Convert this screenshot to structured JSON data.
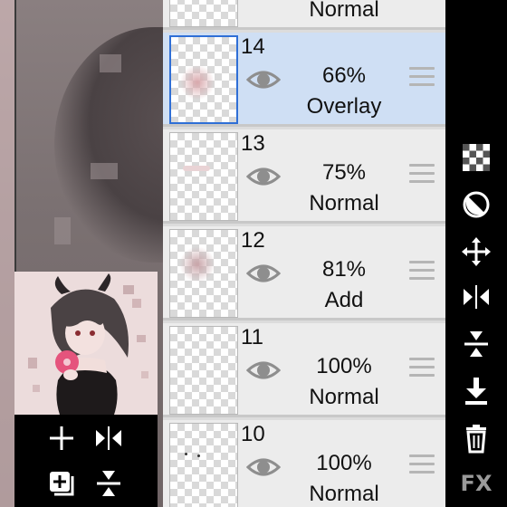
{
  "layers": [
    {
      "number": "",
      "opacity": "",
      "blend_mode": "Normal",
      "selected": false
    },
    {
      "number": "14",
      "opacity": "66%",
      "blend_mode": "Overlay",
      "selected": true
    },
    {
      "number": "13",
      "opacity": "75%",
      "blend_mode": "Normal",
      "selected": false
    },
    {
      "number": "12",
      "opacity": "81%",
      "blend_mode": "Add",
      "selected": false
    },
    {
      "number": "11",
      "opacity": "100%",
      "blend_mode": "Normal",
      "selected": false
    },
    {
      "number": "10",
      "opacity": "100%",
      "blend_mode": "Normal",
      "selected": false
    }
  ],
  "right_toolbar": {
    "fx_label": "FX",
    "icons": [
      "transparency-checker-icon",
      "clipping-icon",
      "move-icon",
      "flip-horizontal-icon",
      "merge-down-icon",
      "download-icon",
      "trash-icon"
    ]
  },
  "left_toolbar": {
    "icons": [
      "add-layer-icon",
      "flip-icon",
      "duplicate-layer-icon",
      "merge-icon"
    ]
  },
  "colors": {
    "selected_layer_bg": "#cfdff4",
    "selected_border": "#2f6fd6",
    "layer_bg": "#ececec",
    "toolbar_bg": "#000000",
    "icon_color": "#ffffff"
  }
}
